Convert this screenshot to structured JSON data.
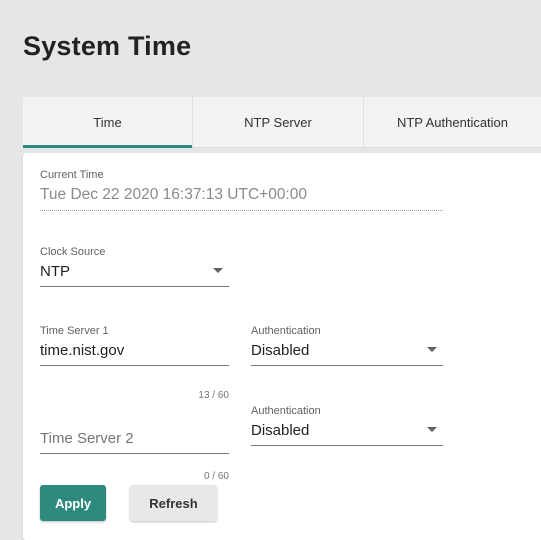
{
  "page": {
    "title": "System Time"
  },
  "tabs": [
    {
      "label": "Time",
      "active": true
    },
    {
      "label": "NTP Server",
      "active": false
    },
    {
      "label": "NTP Authentication",
      "active": false
    }
  ],
  "form": {
    "current_time": {
      "label": "Current Time",
      "value": "Tue Dec 22 2020 16:37:13 UTC+00:00"
    },
    "clock_source": {
      "label": "Clock Source",
      "value": "NTP"
    },
    "time_server_1": {
      "label": "Time Server 1",
      "value": "time.nist.gov",
      "counter": "13 / 60"
    },
    "authentication_1": {
      "label": "Authentication",
      "value": "Disabled"
    },
    "time_server_2": {
      "placeholder": "Time Server 2",
      "value": "",
      "counter": "0 / 60"
    },
    "authentication_2": {
      "label": "Authentication",
      "value": "Disabled"
    }
  },
  "buttons": {
    "apply_label": "Apply",
    "refresh_label": "Refresh"
  },
  "colors": {
    "accent": "#2e8a7e",
    "background": "#e6e6e6",
    "card": "#ffffff"
  },
  "icons": {
    "dropdown": "chevron-down-icon"
  }
}
